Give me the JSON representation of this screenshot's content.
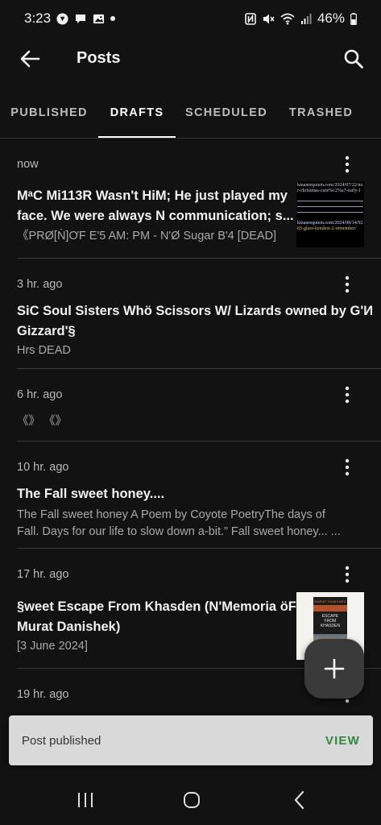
{
  "status_bar": {
    "time": "3:23",
    "battery": "46%",
    "left_icons": [
      "threads-icon",
      "chat-bubble-icon",
      "image-icon",
      "dot-icon"
    ],
    "right_icons": [
      "nfc-icon",
      "mute-icon",
      "wifi-icon",
      "signal-icon",
      "battery-icon"
    ]
  },
  "app_bar": {
    "title": "Posts",
    "back_icon": "arrow-left-icon",
    "search_icon": "search-icon"
  },
  "tabs": [
    {
      "label": "PUBLISHED",
      "active": false
    },
    {
      "label": "DRAFTS",
      "active": true
    },
    {
      "label": "SCHEDULED",
      "active": false
    },
    {
      "label": "TRASHED",
      "active": false
    }
  ],
  "posts": [
    {
      "time": "now",
      "title_line1": "MᵃC Mi113R Wasn't HiM; He just played my",
      "title_line2": "face. We were always N communication; s...",
      "excerpt_line1": "《PRØ[Ṅ]ƠF E'5 AM: PM - N'Ø Sugar B'4 [DEAD]",
      "thumbnail": {
        "line1": "kmanrequiem.com/2024/07/22/no",
        "line2": "r-christmas-cure%c2%a7-early-l",
        "line3": "kmanrequiem.com/2024/08/14/92",
        "line4": "83-glare-kenders-2-remember/"
      }
    },
    {
      "time": "3 hr. ago",
      "title_line1": "SiC Soul Sisters Whö Scissors W/ Lizards owned by G'И",
      "title_line2": "Gizzard'§",
      "excerpt_line1": "Hrs DEAD"
    },
    {
      "time": "6 hr. ago",
      "title_line1": "",
      "excerpt_line1": "《》 《》"
    },
    {
      "time": "10 hr. ago",
      "title_line1": "The Fall sweet honey....",
      "excerpt_line1": "The Fall sweet honey A Poem by Coyote PoetryThe days of",
      "excerpt_line2": "Fall. Days for our life to slow down a-bit.” Fall sweet honey... ..."
    },
    {
      "time": "17 hr. ago",
      "title_line1": "§weet Escape From Khasden (N'Memoria öF",
      "title_line2": "Murat Danishek)",
      "excerpt_line1": "[3 June 2024]",
      "thumbnail": {
        "author": "MURAT DANISHEK",
        "book_title_1": "ESCAPE",
        "book_title_2": "FROM",
        "book_title_3": "KHASDEN"
      }
    },
    {
      "time": "19 hr. ago"
    }
  ],
  "fab": {
    "icon": "plus-icon"
  },
  "snackbar": {
    "message": "Post published",
    "action": "VIEW"
  },
  "nav_bar": {
    "recents_icon": "recents-icon",
    "home_icon": "home-icon",
    "back_icon": "nav-back-icon"
  },
  "colors": {
    "background": "#121212",
    "snackbar_bg": "#d9d9d9",
    "snackbar_action": "#2e8b3a",
    "fab_bg": "#3a3a3a"
  }
}
